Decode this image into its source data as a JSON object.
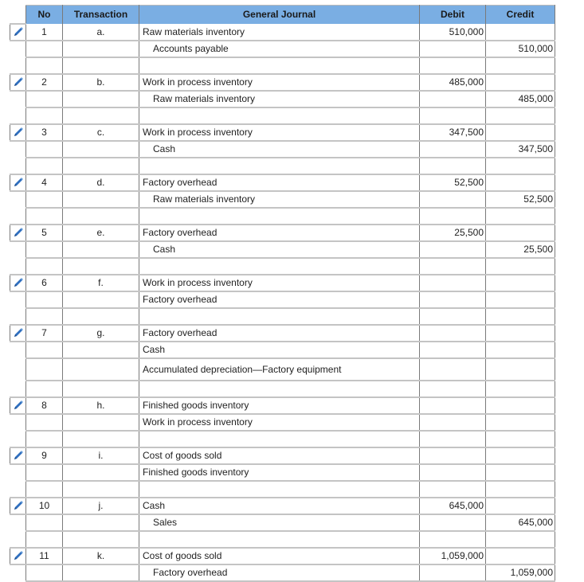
{
  "headers": {
    "no": "No",
    "transaction": "Transaction",
    "journal": "General Journal",
    "debit": "Debit",
    "credit": "Credit"
  },
  "icons": {
    "edit": "pencil-icon"
  },
  "colors": {
    "header_bg": "#7aaee3",
    "pencil": "#2f6fbf"
  },
  "entries": [
    {
      "no": "1",
      "tr": "a.",
      "lines": [
        {
          "account": "Raw materials inventory",
          "indent": false,
          "debit": "510,000",
          "credit": ""
        },
        {
          "account": "Accounts payable",
          "indent": true,
          "debit": "",
          "credit": "510,000"
        },
        {
          "account": "",
          "indent": false,
          "debit": "",
          "credit": ""
        }
      ]
    },
    {
      "no": "2",
      "tr": "b.",
      "lines": [
        {
          "account": "Work in process inventory",
          "indent": false,
          "debit": "485,000",
          "credit": ""
        },
        {
          "account": "Raw materials inventory",
          "indent": true,
          "debit": "",
          "credit": "485,000"
        },
        {
          "account": "",
          "indent": false,
          "debit": "",
          "credit": ""
        }
      ]
    },
    {
      "no": "3",
      "tr": "c.",
      "lines": [
        {
          "account": "Work in process inventory",
          "indent": false,
          "debit": "347,500",
          "credit": ""
        },
        {
          "account": "Cash",
          "indent": true,
          "debit": "",
          "credit": "347,500"
        },
        {
          "account": "",
          "indent": false,
          "debit": "",
          "credit": ""
        }
      ]
    },
    {
      "no": "4",
      "tr": "d.",
      "lines": [
        {
          "account": "Factory overhead",
          "indent": false,
          "debit": "52,500",
          "credit": ""
        },
        {
          "account": "Raw materials inventory",
          "indent": true,
          "debit": "",
          "credit": "52,500"
        },
        {
          "account": "",
          "indent": false,
          "debit": "",
          "credit": ""
        }
      ]
    },
    {
      "no": "5",
      "tr": "e.",
      "lines": [
        {
          "account": "Factory overhead",
          "indent": false,
          "debit": "25,500",
          "credit": ""
        },
        {
          "account": "Cash",
          "indent": true,
          "debit": "",
          "credit": "25,500"
        },
        {
          "account": "",
          "indent": false,
          "debit": "",
          "credit": ""
        }
      ]
    },
    {
      "no": "6",
      "tr": "f.",
      "lines": [
        {
          "account": "Work in process inventory",
          "indent": false,
          "debit": "",
          "credit": ""
        },
        {
          "account": "Factory overhead",
          "indent": false,
          "debit": "",
          "credit": ""
        },
        {
          "account": "",
          "indent": false,
          "debit": "",
          "credit": ""
        }
      ]
    },
    {
      "no": "7",
      "tr": "g.",
      "lines": [
        {
          "account": "Factory overhead",
          "indent": false,
          "debit": "",
          "credit": ""
        },
        {
          "account": "Cash",
          "indent": false,
          "debit": "",
          "credit": ""
        },
        {
          "account": "Accumulated depreciation—Factory equipment",
          "indent": false,
          "debit": "",
          "credit": "",
          "tall": true
        },
        {
          "account": "",
          "indent": false,
          "debit": "",
          "credit": ""
        }
      ]
    },
    {
      "no": "8",
      "tr": "h.",
      "lines": [
        {
          "account": "Finished goods inventory",
          "indent": false,
          "debit": "",
          "credit": ""
        },
        {
          "account": "Work in process inventory",
          "indent": false,
          "debit": "",
          "credit": ""
        },
        {
          "account": "",
          "indent": false,
          "debit": "",
          "credit": ""
        }
      ]
    },
    {
      "no": "9",
      "tr": "i.",
      "lines": [
        {
          "account": "Cost of goods sold",
          "indent": false,
          "debit": "",
          "credit": ""
        },
        {
          "account": "Finished goods inventory",
          "indent": false,
          "debit": "",
          "credit": ""
        },
        {
          "account": "",
          "indent": false,
          "debit": "",
          "credit": ""
        }
      ]
    },
    {
      "no": "10",
      "tr": "j.",
      "lines": [
        {
          "account": "Cash",
          "indent": false,
          "debit": "645,000",
          "credit": ""
        },
        {
          "account": "Sales",
          "indent": true,
          "debit": "",
          "credit": "645,000"
        },
        {
          "account": "",
          "indent": false,
          "debit": "",
          "credit": ""
        }
      ]
    },
    {
      "no": "11",
      "tr": "k.",
      "lines": [
        {
          "account": "Cost of goods sold",
          "indent": false,
          "debit": "1,059,000",
          "credit": ""
        },
        {
          "account": "Factory overhead",
          "indent": true,
          "debit": "",
          "credit": "1,059,000"
        }
      ]
    }
  ]
}
